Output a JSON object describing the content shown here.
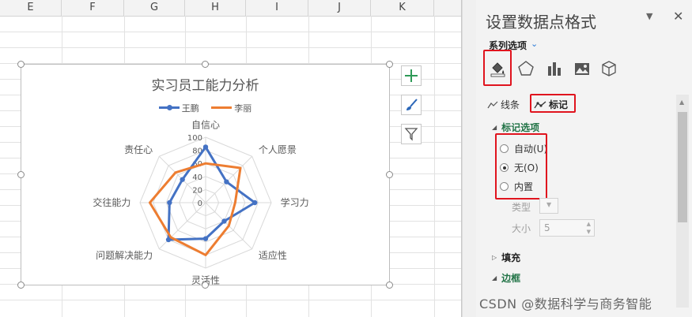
{
  "sheet": {
    "columns": [
      "E",
      "F",
      "G",
      "H",
      "I",
      "J",
      "K"
    ]
  },
  "chart": {
    "side_buttons": [
      "plus-icon",
      "brush-icon",
      "filter-icon"
    ]
  },
  "chart_data": {
    "type": "radar",
    "title": "实习员工能力分析",
    "categories": [
      "自信心",
      "个人愿景",
      "学习力",
      "适应性",
      "灵活性",
      "问题解决能力",
      "交往能力",
      "责任心"
    ],
    "radial_ticks": [
      "0",
      "20",
      "40",
      "60",
      "80",
      "100"
    ],
    "rmax": 100,
    "legend_position": "top",
    "series": [
      {
        "name": "王鹏",
        "color": "#4472c4",
        "values": [
          85,
          45,
          75,
          40,
          55,
          80,
          55,
          50
        ]
      },
      {
        "name": "李丽",
        "color": "#ed7d31",
        "values": [
          60,
          75,
          45,
          50,
          80,
          75,
          85,
          65
        ]
      }
    ]
  },
  "panel": {
    "title": "设置数据点格式",
    "series_options_label": "系列选项",
    "icons": [
      "fill-line-icon",
      "pentagon-effects-icon",
      "bar-chart-icon",
      "picture-icon",
      "cube-icon"
    ],
    "tab_line": "线条",
    "tab_marker": "标记",
    "marker_options_label": "标记选项",
    "radio_auto": "自动(U)",
    "radio_none": "无(O)",
    "radio_builtin": "内置",
    "selected_radio": "无(O)",
    "type_label": "类型",
    "size_label": "大小",
    "size_value": "5",
    "fill_label": "填充",
    "border_label": "边框",
    "accent_color": "#217346",
    "highlight_color": "#e0141e"
  },
  "watermark": "CSDN @数据科学与商务智能"
}
